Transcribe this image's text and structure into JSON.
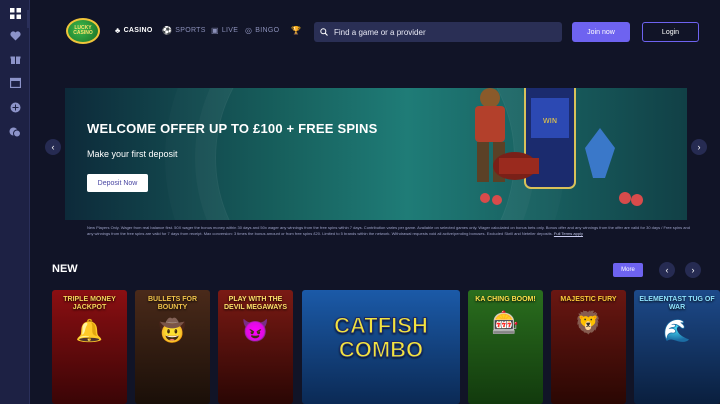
{
  "sidebar": {
    "icons": [
      "grid-icon",
      "heart-icon",
      "gift-icon",
      "calendar-icon",
      "plus-circle-icon",
      "chat-icon"
    ]
  },
  "logo": {
    "text": "LUCKY CASINO"
  },
  "nav": {
    "casino": "CASINO",
    "sports": "SPORTS",
    "live": "LIVE",
    "bingo": "BINGO"
  },
  "search": {
    "placeholder": "Find a game or a provider"
  },
  "header": {
    "join_label": "Join now",
    "login_label": "Login"
  },
  "hero": {
    "title": "WELCOME OFFER UP TO £100 + FREE SPINS",
    "subtitle": "Make your first deposit",
    "cta": "Deposit Now"
  },
  "terms": {
    "text": "New Players Only. Wager from real balance first. 50X wager the bonus money within 30 days and 50x wager any winnings from the free spins within 7 days. Contribution varies per game. Available on selected games only. Wager calculated on bonus bets only. Bonus offer and any winnings from the offer are valid for 30 days / Free spins and any winnings from the free spins are valid for 7 days from receipt. Max conversion: 3 times the bonus amount or from free spins £20. Limited to 5 brands within the network. Withdrawal requests void all active/pending bonuses. Excluded Skrill and Neteller deposits.",
    "link": "Full Terms apply"
  },
  "new_section": {
    "title": "NEW",
    "more_label": "More"
  },
  "games": [
    {
      "name": "TRIPLE MONEY JACKPOT",
      "color": "#8b0f12"
    },
    {
      "name": "BULLETS FOR BOUNTY",
      "color": "#4a2a1a"
    },
    {
      "name": "PLAY WITH THE DEVIL MEGAWAYS",
      "color": "#7a1a14"
    },
    {
      "name": "CATFISH COMBO",
      "color": "#1b5aa8"
    },
    {
      "name": "KA CHING BOOM!",
      "color": "#2a6e1e"
    },
    {
      "name": "MAJESTIC FURY",
      "color": "#6a1712"
    },
    {
      "name": "ELEMENTAST TUG OF WAR",
      "color": "#1d4a8a"
    }
  ]
}
